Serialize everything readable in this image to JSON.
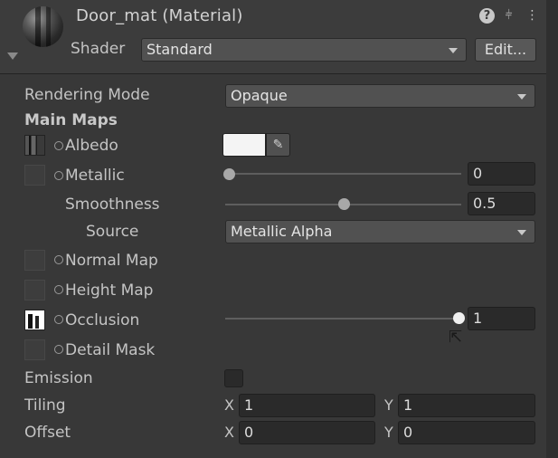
{
  "header": {
    "title": "Door_mat (Material)",
    "shader_label": "Shader",
    "shader_value": "Standard",
    "edit_label": "Edit..."
  },
  "rendering_mode": {
    "label": "Rendering Mode",
    "value": "Opaque"
  },
  "main_maps": {
    "heading": "Main Maps"
  },
  "albedo": {
    "label": "Albedo",
    "color": "#f4f4f4"
  },
  "metallic": {
    "label": "Metallic",
    "value": "0",
    "slider_fraction": 0.0
  },
  "smoothness": {
    "label": "Smoothness",
    "value": "0.5",
    "slider_fraction": 0.5
  },
  "source": {
    "label": "Source",
    "value": "Metallic Alpha"
  },
  "normal_map": {
    "label": "Normal Map"
  },
  "height_map": {
    "label": "Height Map"
  },
  "occlusion": {
    "label": "Occlusion",
    "value": "1",
    "slider_fraction": 1.0
  },
  "detail_mask": {
    "label": "Detail Mask"
  },
  "emission": {
    "label": "Emission",
    "checked": false
  },
  "tiling": {
    "label": "Tiling",
    "x_label": "X",
    "x": "1",
    "y_label": "Y",
    "y": "1"
  },
  "offset": {
    "label": "Offset",
    "x_label": "X",
    "x": "0",
    "y_label": "Y",
    "y": "0"
  },
  "icons": {
    "help": "?",
    "presets": "⫩",
    "more": "⋮",
    "eyedropper": "✎"
  },
  "colors": {
    "panel": "#383838",
    "field": "#2a2a2a",
    "dropdown": "#515151"
  }
}
